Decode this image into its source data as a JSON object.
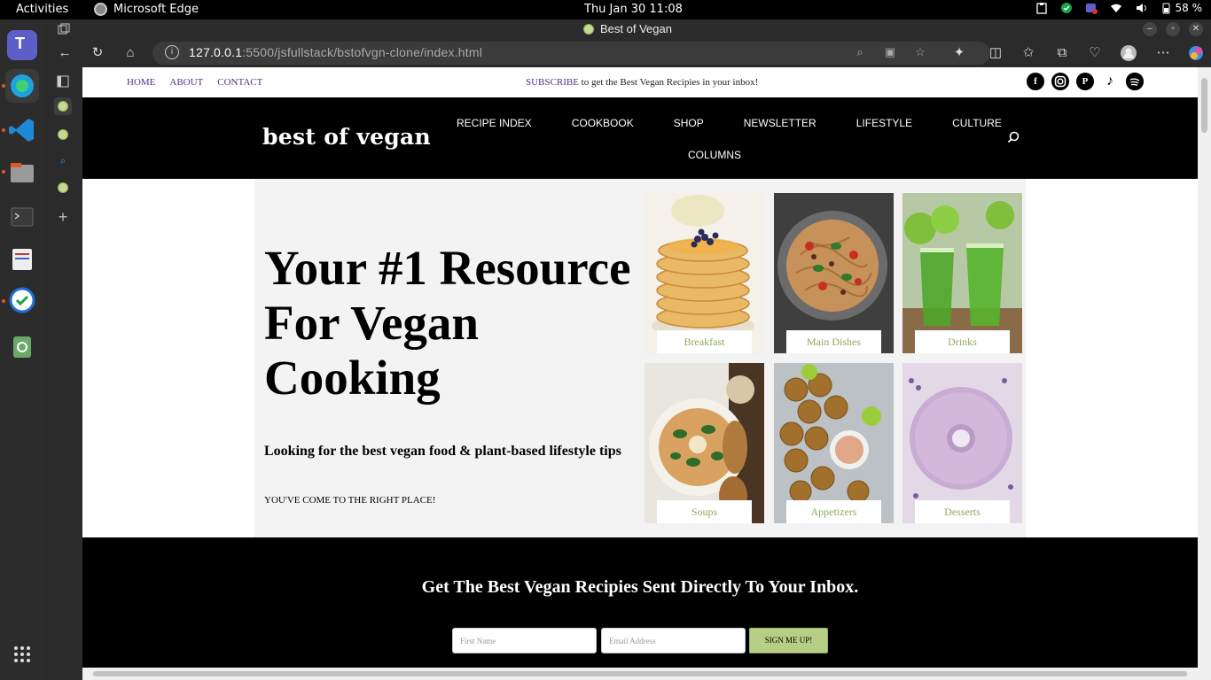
{
  "system": {
    "activities": "Activities",
    "app_name": "Microsoft Edge",
    "clock": "Thu Jan 30  11:08",
    "battery": "58 %"
  },
  "browser": {
    "tab_title": "Best of Vegan",
    "url_host": "127.0.0.1",
    "url_rest": ":5500/jsfullstack/bstofvgn-clone/index.html"
  },
  "site": {
    "top_links": [
      "HOME",
      "ABOUT",
      "CONTACT"
    ],
    "promo_link": "SUBSCRIBE",
    "promo_text": " to get the Best Vegan Recipies in your inbox!",
    "socials": [
      "facebook-icon",
      "instagram-icon",
      "pinterest-icon",
      "tiktok-icon",
      "spotify-icon"
    ],
    "logo": "best of vegan",
    "nav": [
      "RECIPE INDEX",
      "COOKBOOK",
      "SHOP",
      "NEWSLETTER",
      "LIFESTYLE",
      "CULTURE",
      "COLUMNS"
    ],
    "hero": {
      "title": "Your #1 Resource For Vegan Cooking",
      "tagline": "Looking for the best vegan food & plant-based lifestyle tips",
      "subline": "YOU'VE COME TO THE RIGHT PLACE!"
    },
    "categories": [
      "Breakfast",
      "Main Dishes",
      "Drinks",
      "Soups",
      "Appetizers",
      "Desserts"
    ],
    "newsletter": {
      "heading": "Get The Best Vegan Recipies Sent Directly To Your Inbox.",
      "first_name_placeholder": "First Name",
      "email_placeholder": "Email Address",
      "button": "SIGN ME UP!"
    }
  },
  "colors": {
    "accent_green": "#b7cf85",
    "link_purple": "#5b2d8c",
    "label_green": "#8fa95b"
  }
}
